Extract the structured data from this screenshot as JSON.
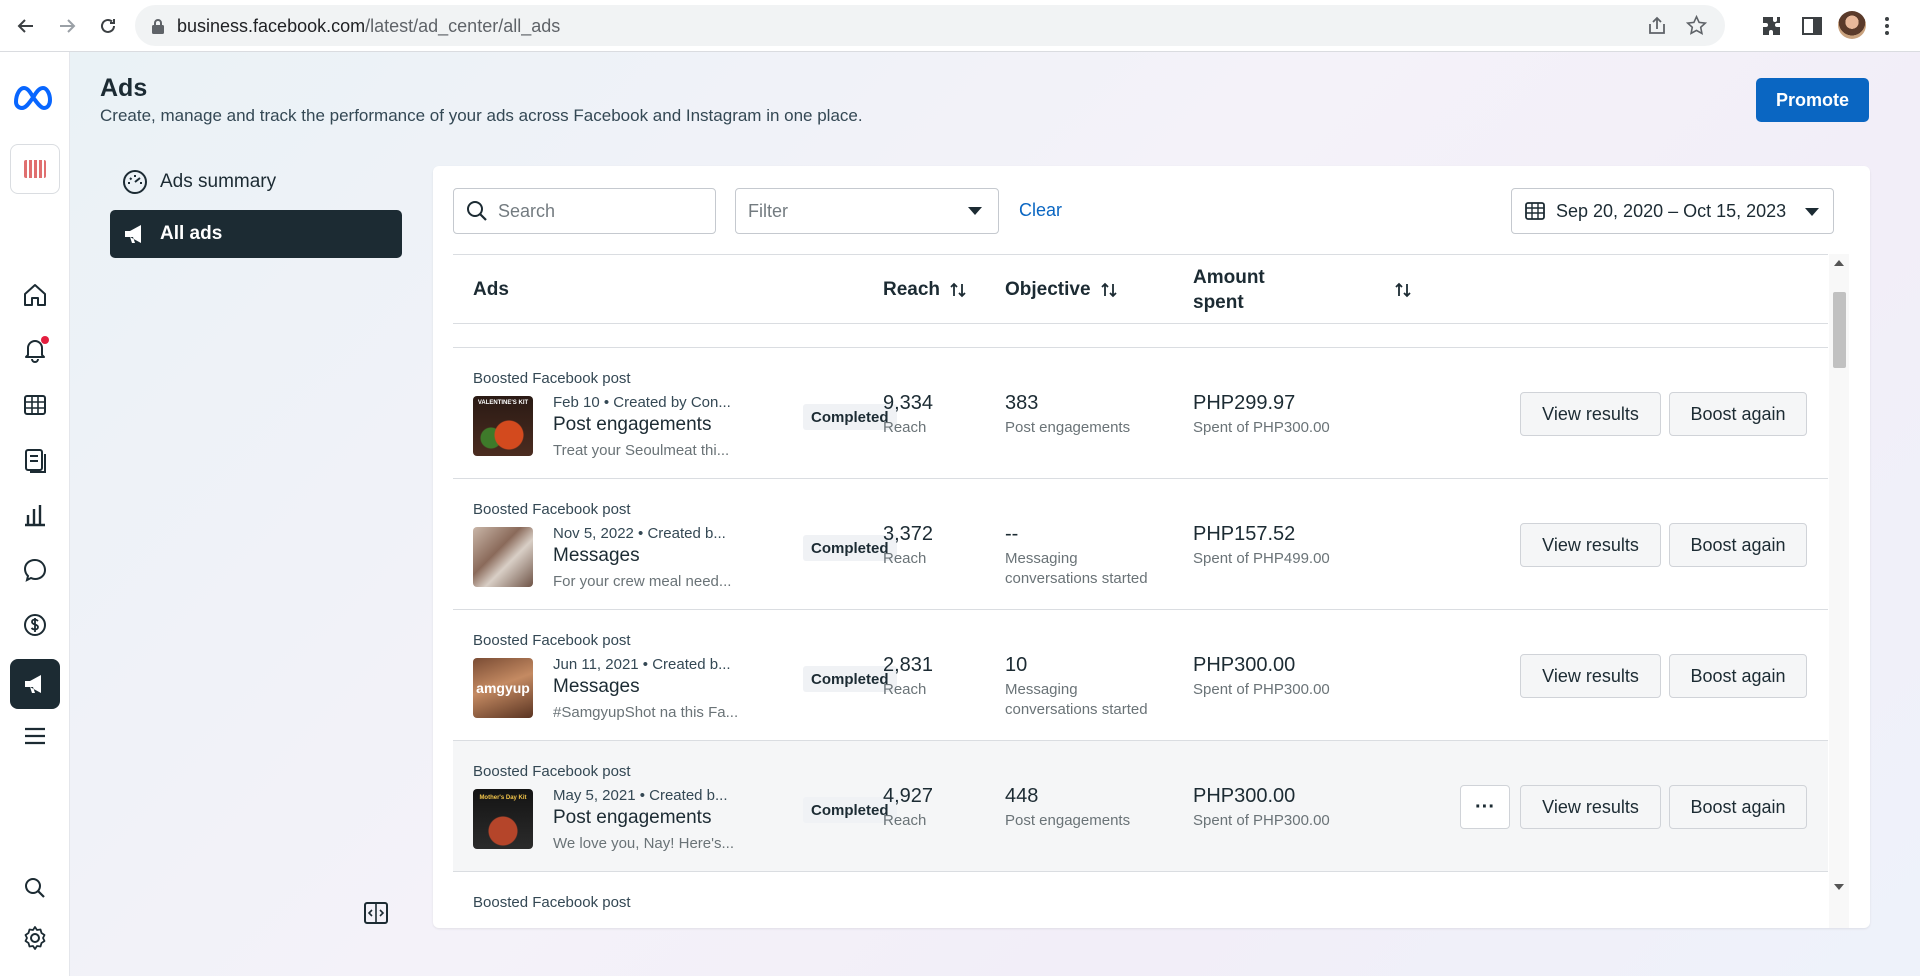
{
  "browser": {
    "url_host": "business.facebook.com",
    "url_path": "/latest/ad_center/all_ads"
  },
  "header": {
    "title": "Ads",
    "subtitle": "Create, manage and track the performance of your ads across Facebook and Instagram in one place.",
    "promote_label": "Promote"
  },
  "subnav": {
    "items": [
      {
        "label": "Ads summary",
        "icon": "gauge-icon",
        "active": false
      },
      {
        "label": "All ads",
        "icon": "megaphone-icon",
        "active": true
      }
    ]
  },
  "toolbar": {
    "search_placeholder": "Search",
    "filter_placeholder": "Filter",
    "clear_label": "Clear",
    "date_range": "Sep 20, 2020 – Oct 15, 2023"
  },
  "table": {
    "columns": {
      "ads": "Ads",
      "reach": "Reach",
      "objective": "Objective",
      "amount_spent": "Amount spent"
    },
    "rows": [
      {
        "kind": "Boosted Facebook post",
        "meta": "Feb 10 • Created by Con...",
        "name": "Post engagements",
        "desc": "Treat your Seoulmeat thi...",
        "status": "Completed",
        "reach": "9,334",
        "reach_label": "Reach",
        "objective_value": "383",
        "objective_label": "Post engagements",
        "amount": "PHP299.97",
        "amount_label": "Spent of PHP300.00",
        "view_label": "View results",
        "boost_label": "Boost again"
      },
      {
        "kind": "Boosted Facebook post",
        "meta": "Nov 5, 2022 • Created b...",
        "name": "Messages",
        "desc": "For your crew meal need...",
        "status": "Completed",
        "reach": "3,372",
        "reach_label": "Reach",
        "objective_value": "--",
        "objective_label": "Messaging conversations started",
        "amount": "PHP157.52",
        "amount_label": "Spent of PHP499.00",
        "view_label": "View results",
        "boost_label": "Boost again"
      },
      {
        "kind": "Boosted Facebook post",
        "meta": "Jun 11, 2021 • Created b...",
        "name": "Messages",
        "desc": "#SamgyupShot na this Fa...",
        "status": "Completed",
        "reach": "2,831",
        "reach_label": "Reach",
        "objective_value": "10",
        "objective_label": "Messaging conversations started",
        "amount": "PHP300.00",
        "amount_label": "Spent of PHP300.00",
        "view_label": "View results",
        "boost_label": "Boost again"
      },
      {
        "kind": "Boosted Facebook post",
        "meta": "May 5, 2021 • Created b...",
        "name": "Post engagements",
        "desc": "We love you, Nay! Here's...",
        "status": "Completed",
        "reach": "4,927",
        "reach_label": "Reach",
        "objective_value": "448",
        "objective_label": "Post engagements",
        "amount": "PHP300.00",
        "amount_label": "Spent of PHP300.00",
        "view_label": "View results",
        "boost_label": "Boost again",
        "more_label": "···"
      },
      {
        "kind": "Boosted Facebook post"
      }
    ]
  },
  "thumbs": {
    "row1_text": "VALENTINE'S KIT",
    "row3_text": "amgyup",
    "row4_text": "Mother's Day Kit"
  },
  "colors": {
    "accent": "#0a66c2",
    "dark": "#1c2b33",
    "notification": "#e41e3f"
  }
}
